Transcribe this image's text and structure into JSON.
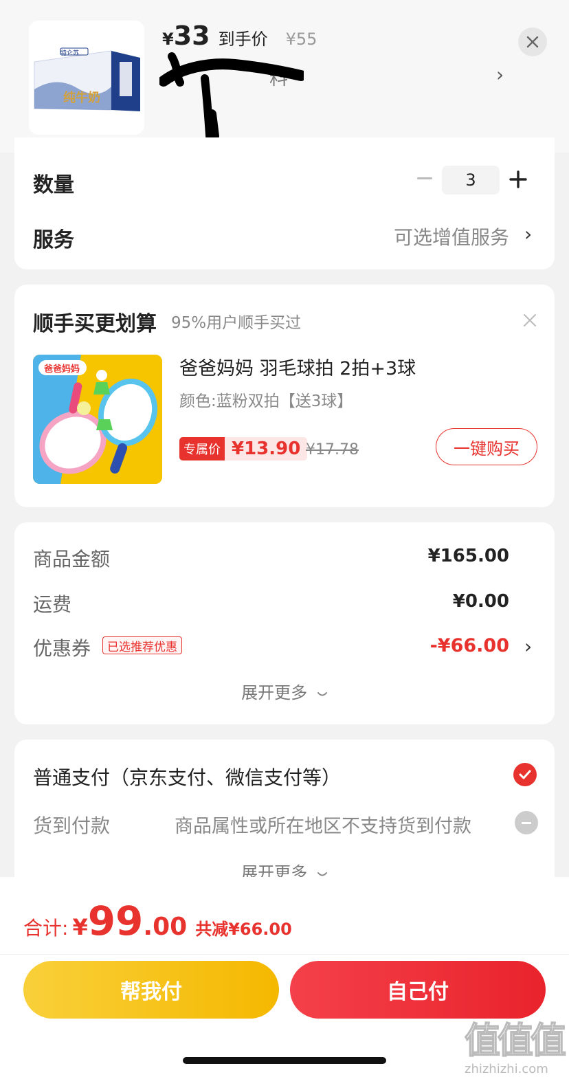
{
  "product": {
    "price_currency": "¥",
    "price_value": "33",
    "price_tag": "到手价",
    "original_price": "¥55",
    "name_visible": "料",
    "image_label_brand": "特仑苏",
    "image_label_product": "纯牛奶"
  },
  "quantity": {
    "label": "数量",
    "value": "3"
  },
  "service": {
    "label": "服务",
    "value": "可选增值服务"
  },
  "upsell": {
    "title": "顺手买更划算",
    "subtitle": "95%用户顺手买过",
    "item_name": "爸爸妈妈 羽毛球拍 2拍+3球",
    "item_spec": "颜色:蓝粉双拍【送3球】",
    "exclusive_tag": "专属价",
    "exclusive_price": "¥13.90",
    "original_price": "¥17.78",
    "buy_label": "一键购买",
    "image_sticker": "爸爸妈妈"
  },
  "summary": {
    "goods_label": "商品金额",
    "goods_value": "¥165.00",
    "shipping_label": "运费",
    "shipping_value": "¥0.00",
    "coupon_label": "优惠券",
    "coupon_badge": "已选推荐优惠",
    "coupon_value": "-¥66.00",
    "expand_label": "展开更多"
  },
  "payment": {
    "normal_label": "普通支付（京东支付、微信支付等）",
    "cod_label": "货到付款",
    "cod_note": "商品属性或所在地区不支持货到付款",
    "expand_label": "展开更多"
  },
  "bottom": {
    "total_label": "合计:",
    "total_currency": "¥",
    "total_int": "99",
    "total_dec": ".00",
    "saved_text": "共减¥66.00",
    "help_pay": "帮我付",
    "self_pay": "自己付"
  },
  "watermark": {
    "glyph": "值值值",
    "url": "zhizhizhi.com"
  },
  "colors": {
    "accent": "#e8322e",
    "help_button": "#f5b800",
    "self_button": "#e9232c"
  }
}
